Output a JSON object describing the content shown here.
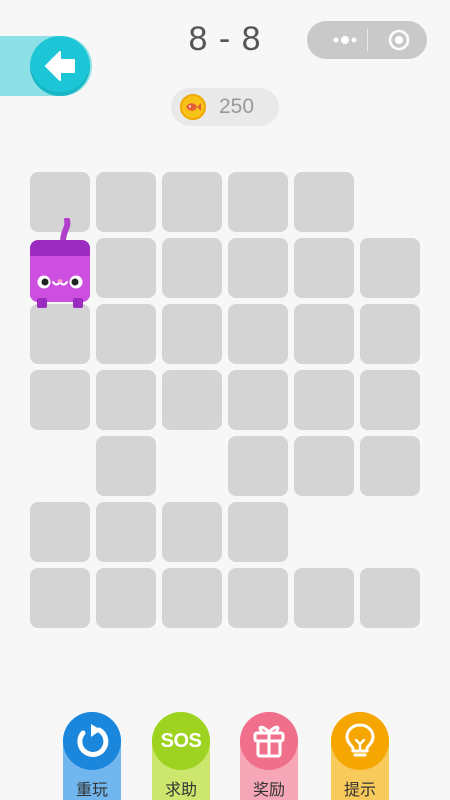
{
  "header": {
    "level_title": "8 - 8",
    "back_icon": "arrow-left-icon",
    "capsule_more_icon": "more-dots-icon",
    "capsule_close_icon": "target-circle-icon"
  },
  "coins": {
    "icon": "fish-coin-icon",
    "count": "250"
  },
  "board": {
    "columns": 6,
    "rows": 7,
    "tiles": [
      [
        1,
        1,
        1,
        1,
        1,
        0
      ],
      [
        1,
        1,
        1,
        1,
        1,
        1
      ],
      [
        1,
        1,
        1,
        1,
        1,
        1
      ],
      [
        1,
        1,
        1,
        1,
        1,
        1
      ],
      [
        0,
        1,
        0,
        1,
        1,
        1
      ],
      [
        1,
        1,
        1,
        1,
        0,
        0
      ],
      [
        1,
        1,
        1,
        1,
        1,
        1
      ]
    ],
    "cat_position": {
      "row": 1,
      "col": 0
    },
    "cat_color": "#b03ec8",
    "tile_color": "#d4d4d4"
  },
  "toolbar": {
    "replay": {
      "label": "重玩",
      "icon": "refresh-icon"
    },
    "sos": {
      "label": "求助",
      "icon_text": "SOS"
    },
    "reward": {
      "label": "奖励",
      "icon": "gift-icon"
    },
    "hint": {
      "label": "提示",
      "icon": "lightbulb-icon"
    }
  },
  "colors": {
    "back_button": "#1cc6d6",
    "replay": "#1a86dc",
    "sos": "#9ed321",
    "reward": "#f0708c",
    "hint": "#f6a600"
  }
}
